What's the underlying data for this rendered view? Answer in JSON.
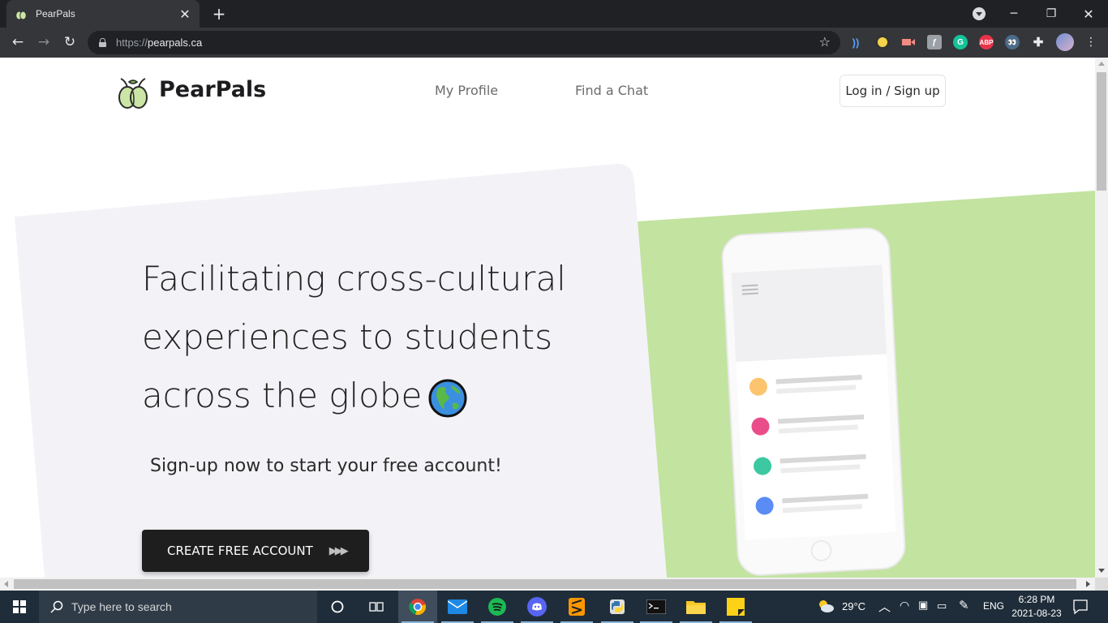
{
  "browser": {
    "tab_title": "PearPals",
    "url_scheme": "https://",
    "url_host": "pearpals.ca",
    "extensions": [
      "audio-icon",
      "record-icon",
      "video-icon",
      "reader-icon",
      "grammarly-icon",
      "adblock-icon",
      "eyes-icon",
      "puzzle-icon",
      "profile-avatar"
    ],
    "adblock_label": "ABP",
    "grammarly_label": "G"
  },
  "site": {
    "brand": "PearPals",
    "nav": [
      "My Profile",
      "Find a Chat"
    ],
    "login_label": "Log in / Sign up"
  },
  "hero": {
    "headline_line1": "Facilitating cross-cultural",
    "headline_line2": "experiences to students",
    "headline_line3": "across the globe",
    "subheadline": "Sign-up now to start your free account!",
    "cta_label": "CREATE FREE ACCOUNT",
    "cta_arrows": "▶▶▶",
    "accent_color": "#c3e3a0",
    "card_color": "#f3f3f7",
    "phone_dots": [
      "#fcc46e",
      "#ea4e8a",
      "#3cc8a0",
      "#5b8cf5"
    ]
  },
  "taskbar": {
    "search_placeholder": "Type here to search",
    "temperature": "29°C",
    "language": "ENG",
    "time": "6:28 PM",
    "date": "2021-08-23"
  }
}
